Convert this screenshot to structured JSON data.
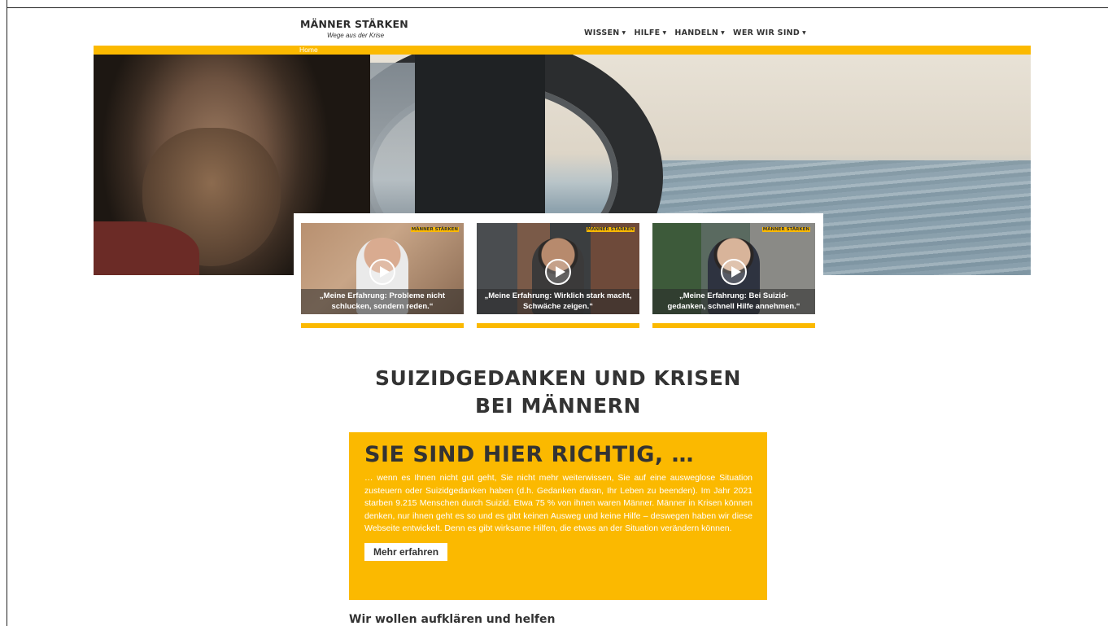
{
  "brand": {
    "name_part1": "MÄNNER ",
    "name_part2": "STÄRKEN",
    "tagline": "Wege aus der Krise",
    "accent_color": "#fbb900"
  },
  "nav": {
    "items": [
      {
        "label": "WISSEN",
        "caret": "▼"
      },
      {
        "label": "HILFE",
        "caret": "▼"
      },
      {
        "label": "HANDELN",
        "caret": "▼"
      },
      {
        "label": "WER WIR SIND",
        "caret": "▼"
      }
    ]
  },
  "breadcrumb": "Home",
  "videos": [
    {
      "caption_line1": "„Meine Erfahrung: Probleme nicht",
      "caption_line2": "schlucken, sondern reden.“",
      "badge": "MÄNNER STÄRKEN"
    },
    {
      "caption_line1": "„Meine Erfahrung: Wirklich stark macht,",
      "caption_line2": "Schwäche zeigen.“",
      "badge": "MÄNNER STÄRKEN"
    },
    {
      "caption_line1": "„Meine Erfahrung: Bei Suizid-",
      "caption_line2": "gedanken, schnell Hilfe annehmen.“",
      "badge": "MÄNNER STÄRKEN"
    }
  ],
  "headline": {
    "line1": "SUIZIDGEDANKEN UND KRISEN",
    "line2": "BEI MÄNNERN"
  },
  "info_box": {
    "title": "SIE SIND HIER RICHTIG, …",
    "text": "… wenn es Ihnen nicht gut geht, Sie nicht mehr weiterwissen, Sie auf eine ausweglose Situation zusteuern oder Suizidgedanken haben (d.h. Gedanken daran, Ihr Leben zu beenden). Im Jahr 2021 starben 9.215 Menschen durch Suizid. Etwa 75 % von ihnen waren Männer. Männer in Krisen können denken, nur ihnen geht es so und es gibt keinen Ausweg und keine Hilfe – deswegen haben wir diese Webseite entwickelt. Denn es gibt wirksame Hilfen, die etwas an der Situation verändern können.",
    "button": "Mehr erfahren"
  },
  "subheading": "Wir wollen aufklären und helfen"
}
